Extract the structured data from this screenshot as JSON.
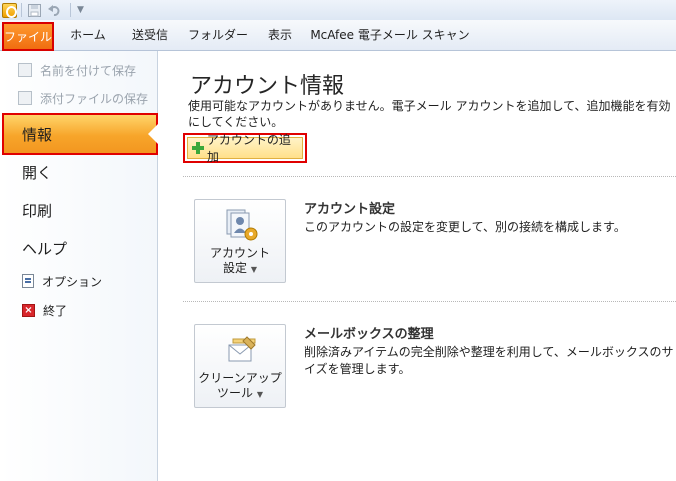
{
  "ribbon": {
    "tabs": [
      "ファイル",
      "ホーム",
      "送受信",
      "フォルダー",
      "表示",
      "McAfee 電子メール スキャン"
    ]
  },
  "nav": {
    "disabled_items": [
      "名前を付けて保存",
      "添付ファイルの保存"
    ],
    "active": "情報",
    "items": [
      "開く",
      "印刷",
      "ヘルプ"
    ],
    "options": "オプション",
    "exit": "終了"
  },
  "main": {
    "title": "アカウント情報",
    "description": "使用可能なアカウントがありません。電子メール アカウントを追加して、追加機能を有効にしてください。",
    "add_account": "アカウントの追加",
    "sections": [
      {
        "button_line1": "アカウント",
        "button_line2": "設定",
        "title": "アカウント設定",
        "description": "このアカウントの設定を変更して、別の接続を構成します。"
      },
      {
        "button_line1": "クリーンアップ",
        "button_line2": "ツール",
        "title": "メールボックスの整理",
        "description": "削除済みアイテムの完全削除や整理を利用して、メールボックスのサイズを管理します。"
      }
    ]
  }
}
